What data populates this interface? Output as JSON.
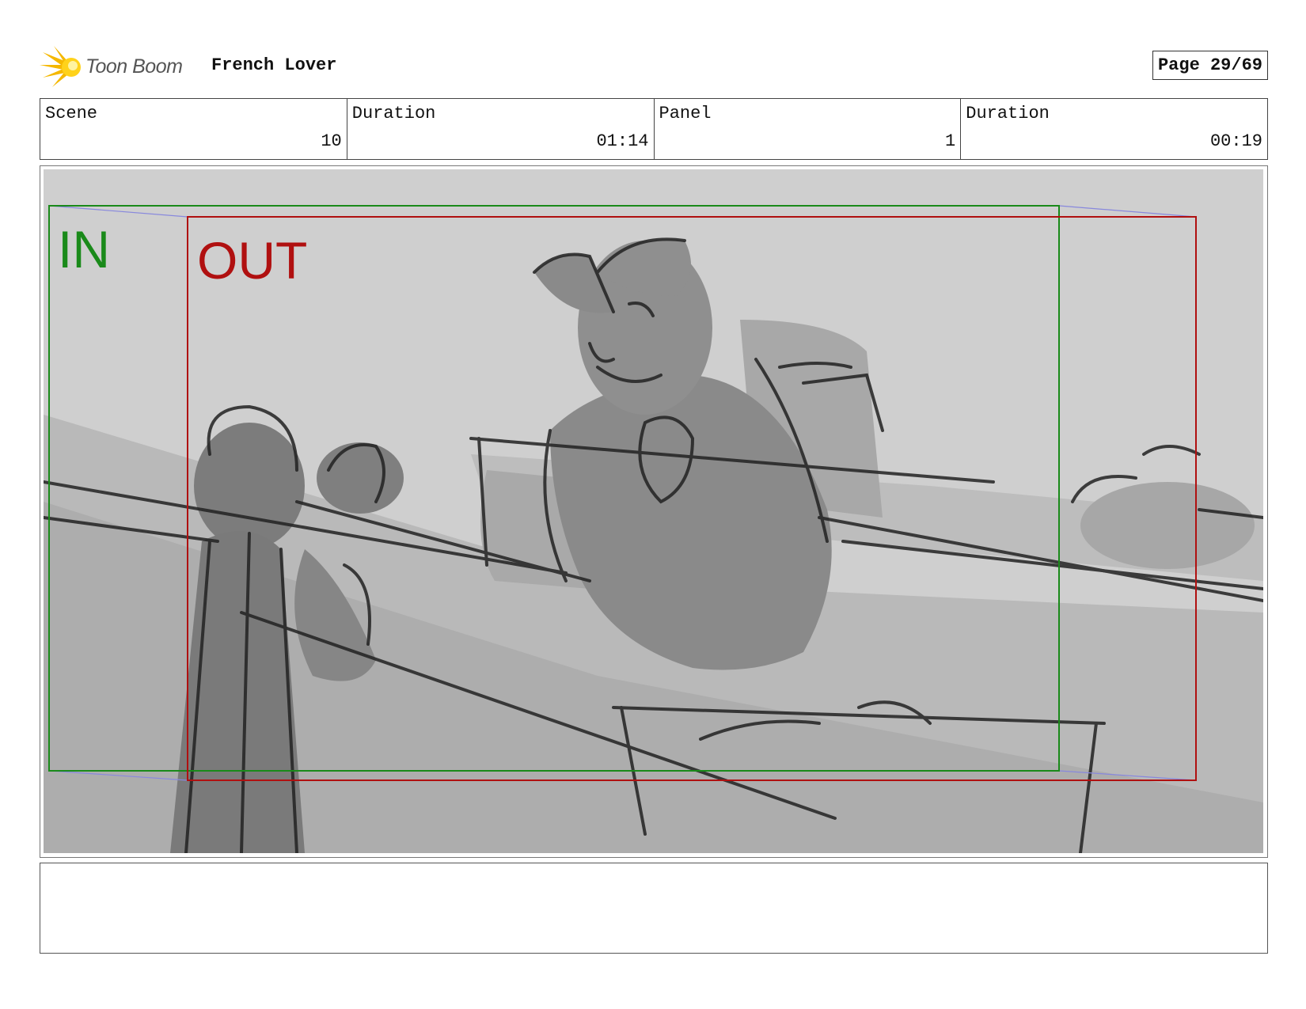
{
  "header": {
    "brand": "Toon Boom",
    "project_title": "French Lover",
    "page_label": "Page 29/69"
  },
  "info": {
    "scene_label": "Scene",
    "scene_value": "10",
    "scene_duration_label": "Duration",
    "scene_duration_value": "01:14",
    "panel_label": "Panel",
    "panel_value": "1",
    "panel_duration_label": "Duration",
    "panel_duration_value": "00:19"
  },
  "frame": {
    "in_label": "IN",
    "out_label": "OUT",
    "in_color": "#1a8a1a",
    "out_color": "#b01010"
  },
  "icons": [
    "toon-boom-logo-icon"
  ]
}
